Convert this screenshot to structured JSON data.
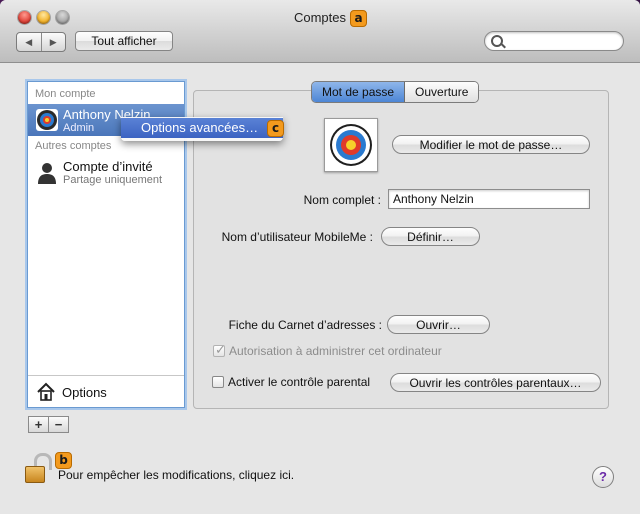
{
  "window": {
    "title": "Comptes"
  },
  "toolbar": {
    "show_all": "Tout afficher",
    "search_placeholder": ""
  },
  "badges": {
    "a": "a",
    "b": "b",
    "c": "c"
  },
  "sidebar": {
    "my_account_header": "Mon compte",
    "my_account": {
      "name": "Anthony Nelzin",
      "role": "Admin"
    },
    "other_accounts_header": "Autres comptes",
    "other_accounts": [
      {
        "name": "Compte d’invité",
        "role": "Partage uniquement"
      }
    ],
    "options_label": "Options",
    "add": "+",
    "remove": "−"
  },
  "context_menu": {
    "item": "Options avancées…"
  },
  "tabs": [
    {
      "label": "Mot de passe",
      "active": true
    },
    {
      "label": "Ouverture",
      "active": false
    }
  ],
  "password_tab": {
    "change_password_button": "Modifier le mot de passe…",
    "full_name_label": "Nom complet :",
    "full_name_value": "Anthony Nelzin",
    "mobileme_label": "Nom d’utilisateur MobileMe :",
    "mobileme_button": "Définir…",
    "address_book_label": "Fiche du Carnet d’adresses :",
    "address_book_button": "Ouvrir…",
    "admin_checkbox_label": "Autorisation à administrer cet ordinateur",
    "admin_checked": true,
    "parental_checkbox_label": "Activer le contrôle parental",
    "parental_checked": false,
    "parental_button": "Ouvrir les contrôles parentaux…"
  },
  "footer": {
    "lock_text": "Pour empêcher les modifications, cliquez ici.",
    "help": "?"
  },
  "colors": {
    "selection": "#4a76ba",
    "badge": "#f39a1d",
    "active_tab": "#4d86d6"
  }
}
